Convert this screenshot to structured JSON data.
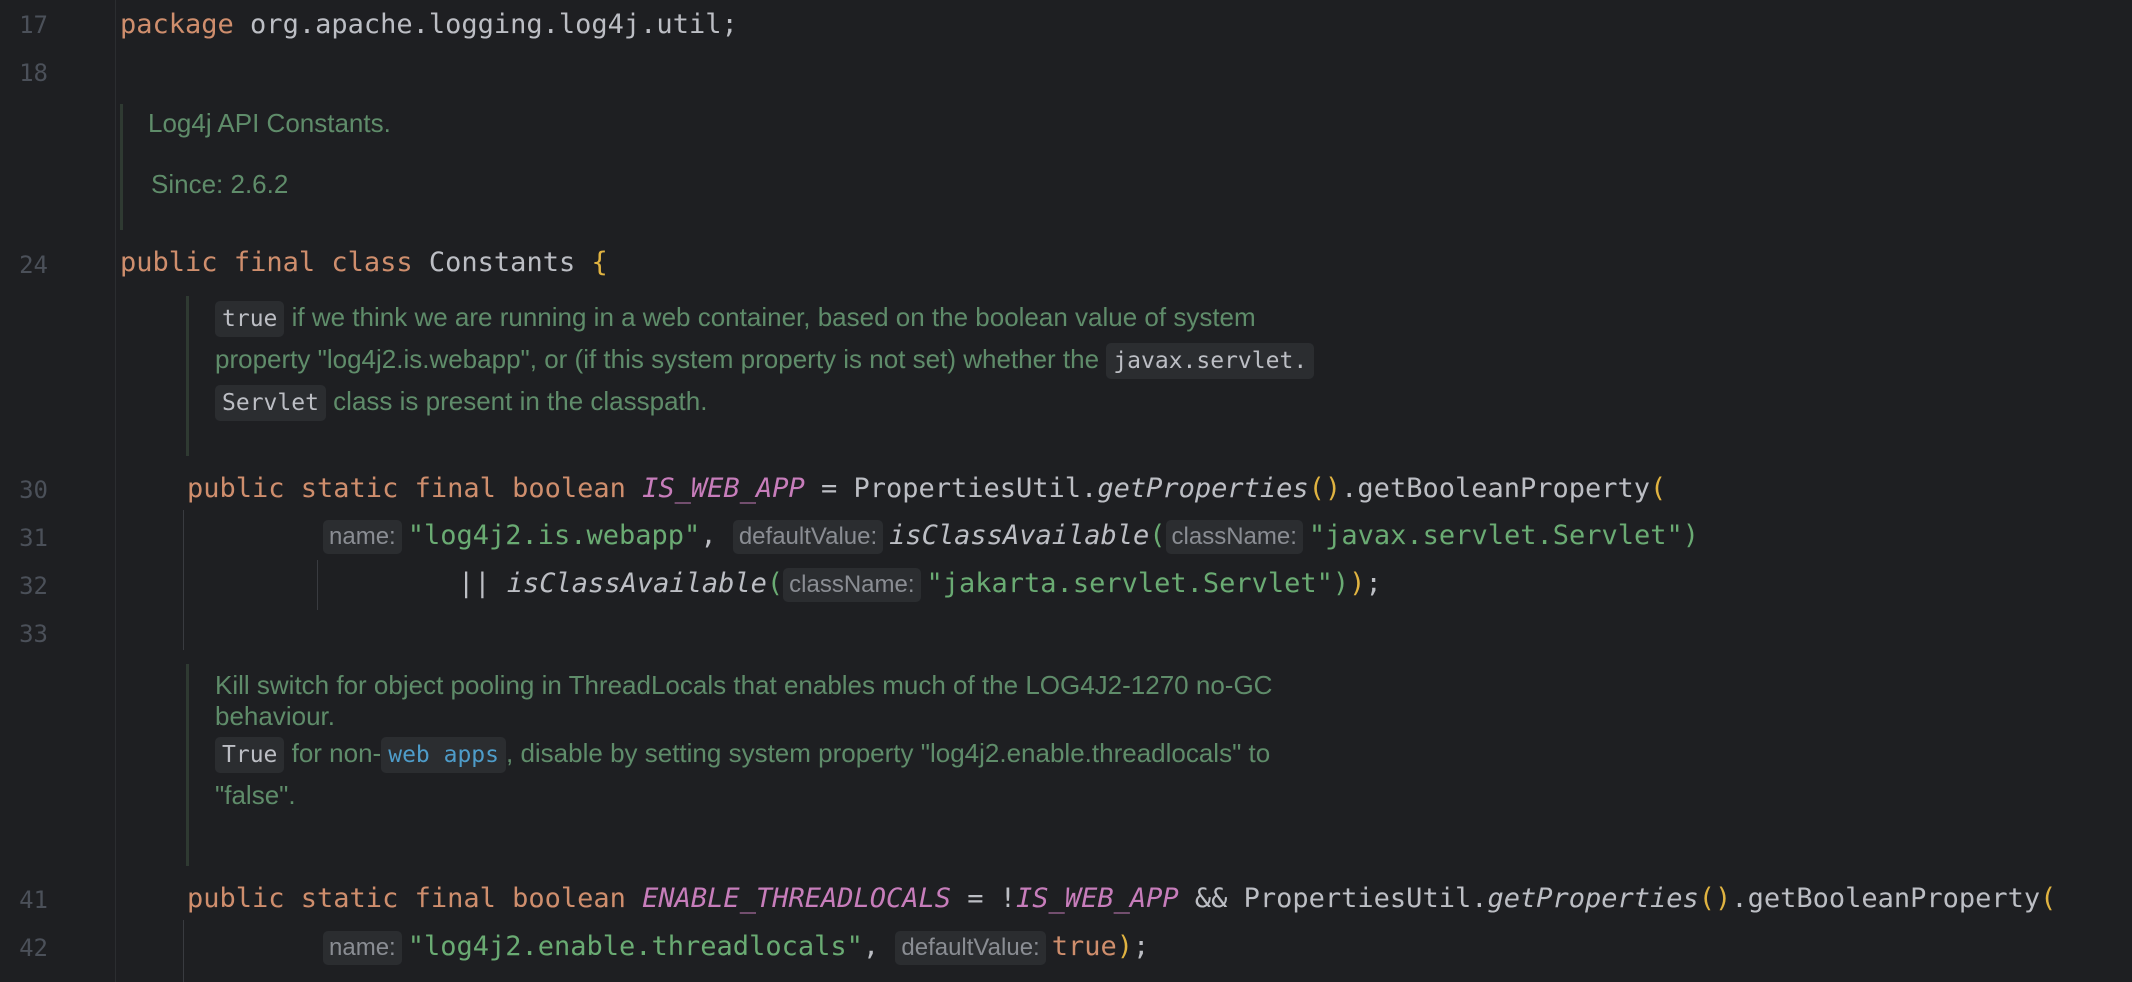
{
  "editor": {
    "lines": {
      "l17": "17",
      "l18": "18",
      "l24": "24",
      "l30": "30",
      "l31": "31",
      "l32": "32",
      "l33": "33",
      "l41": "41",
      "l42": "42"
    },
    "package_kw": "package",
    "package_name": " org.apache.logging.log4j.util;",
    "doc1": {
      "summary": "Log4j API Constants.",
      "since": "Since: 2.6.2"
    },
    "class_decl": {
      "public": "public",
      "final": "final",
      "class": "class",
      "name": "Constants",
      "brace": "{"
    },
    "doc2": {
      "chip_true": "true",
      "text1": " if we think we are running in a web container, based on the boolean value of system",
      "text2": "property \"log4j2.is.webapp\", or (if this system property is not set) whether the ",
      "chip_servlet_pkg": "javax.servlet.",
      "chip_servlet": "Servlet",
      "text3": " class is present in the classpath."
    },
    "line30": {
      "mods": "public static final boolean ",
      "field": "IS_WEB_APP",
      "eq": " = PropertiesUtil.",
      "method": "getProperties",
      "paren": "()",
      "call": ".getBooleanProperty",
      "open": "("
    },
    "line31": {
      "hint_name": "name:",
      "str1": "\"log4j2.is.webapp\"",
      "comma": ", ",
      "hint_default": "defaultValue:",
      "method": "isClassAvailable",
      "open": "(",
      "hint_class": "className:",
      "str2": "\"javax.servlet.Servlet\"",
      "close": ")"
    },
    "line32": {
      "op": "|| ",
      "method": "isClassAvailable",
      "open": "(",
      "hint_class": "className:",
      "str": "\"jakarta.servlet.Servlet\"",
      "close1": ")",
      "close2": ")",
      "semi": ";"
    },
    "doc3": {
      "text1": "Kill switch for object pooling in ThreadLocals that enables much of the LOG4J2-1270 no-GC",
      "text2": "behaviour.",
      "chip_true": "True",
      "text3a": " for non-",
      "chip_link": "web apps",
      "text3b": ", disable by setting system property \"log4j2.enable.threadlocals\" to",
      "text4": "\"false\"."
    },
    "line41": {
      "mods": "public static final boolean ",
      "field": "ENABLE_THREADLOCALS",
      "eq": " = !",
      "field2": "IS_WEB_APP",
      "and": " && PropertiesUtil.",
      "method": "getProperties",
      "paren": "()",
      "call": ".getBooleanProperty",
      "open": "("
    },
    "line42": {
      "hint_name": "name:",
      "str": "\"log4j2.enable.threadlocals\"",
      "comma": ", ",
      "hint_default": "defaultValue:",
      "val": "true",
      "close": ")",
      "semi": ";"
    }
  }
}
